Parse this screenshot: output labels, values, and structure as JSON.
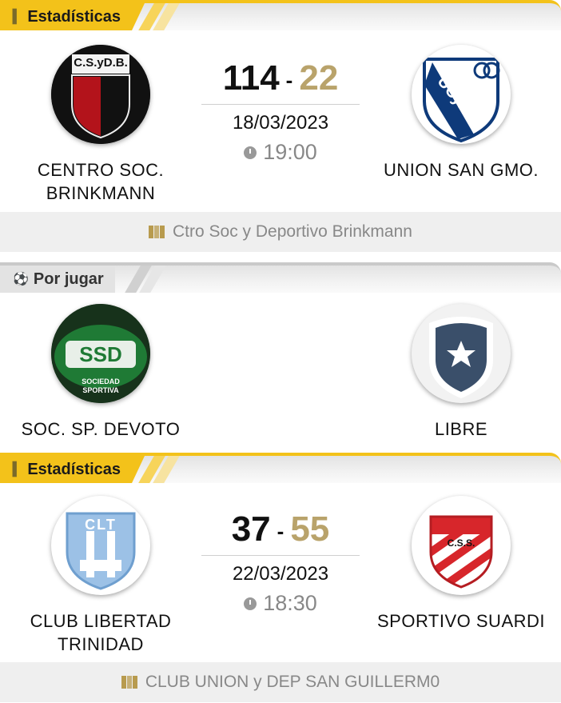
{
  "matches": [
    {
      "tag": "Estadísticas",
      "home": {
        "name": "CENTRO SOC. BRINKMANN",
        "crest_text": "C.S.yD.B."
      },
      "away": {
        "name": "UNION SAN GMO.",
        "crest_text": "UCyD"
      },
      "score_home": "114",
      "score_sep": "-",
      "score_away": "22",
      "date": "18/03/2023",
      "time": "19:00",
      "venue": "Ctro Soc y Deportivo Brinkmann"
    },
    {
      "tag": "Por jugar",
      "home": {
        "name": "SOC. SP. DEVOTO",
        "crest_text": "SSD"
      },
      "away": {
        "name": "LIBRE"
      }
    },
    {
      "tag": "Estadísticas",
      "home": {
        "name": "CLUB LIBERTAD TRINIDAD",
        "crest_text": "CLT"
      },
      "away": {
        "name": "SPORTIVO SUARDI",
        "crest_text": "C.S.S."
      },
      "score_home": "37",
      "score_sep": "-",
      "score_away": "55",
      "date": "22/03/2023",
      "time": "18:30",
      "venue": "CLUB UNION y DEP SAN GUILLERM0"
    }
  ],
  "icons": {
    "stats": "bar-chart-icon",
    "pending": "ball-icon",
    "clock": "clock-icon",
    "venue": "map-icon"
  },
  "colors": {
    "accent": "#f3c21a",
    "away_score": "#b9a36b",
    "venue_icon": "#b89b4e"
  }
}
